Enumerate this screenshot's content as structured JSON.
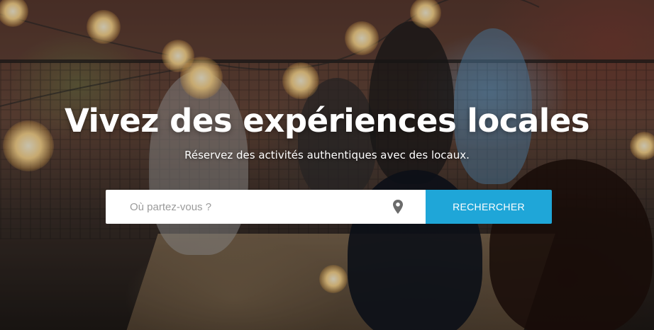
{
  "hero": {
    "title": "Vivez des expériences locales",
    "subtitle": "Réservez des activités authentiques avec des locaux."
  },
  "search": {
    "placeholder": "Où partez-vous ?",
    "location_icon": "map-pin-icon",
    "button_label": "RECHERCHER"
  },
  "colors": {
    "accent": "#1fa6d8",
    "text_on_image": "#ffffff",
    "placeholder": "#9b9b9b"
  }
}
